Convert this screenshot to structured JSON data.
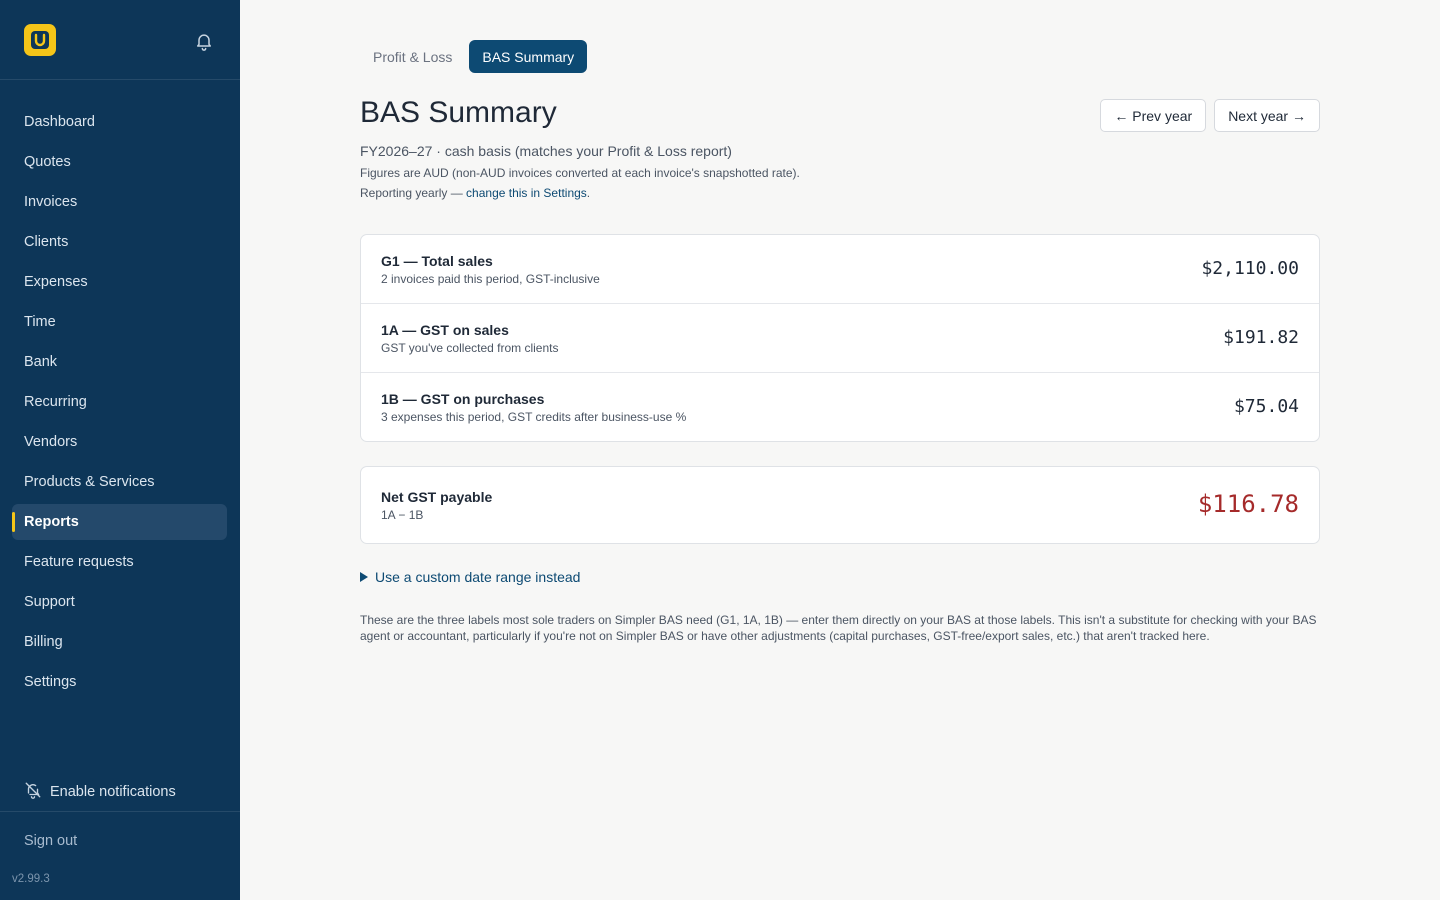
{
  "sidebar": {
    "nav": [
      {
        "label": "Dashboard",
        "active": false
      },
      {
        "label": "Quotes",
        "active": false
      },
      {
        "label": "Invoices",
        "active": false
      },
      {
        "label": "Clients",
        "active": false
      },
      {
        "label": "Expenses",
        "active": false
      },
      {
        "label": "Time",
        "active": false
      },
      {
        "label": "Bank",
        "active": false
      },
      {
        "label": "Recurring",
        "active": false
      },
      {
        "label": "Vendors",
        "active": false
      },
      {
        "label": "Products & Services",
        "active": false
      },
      {
        "label": "Reports",
        "active": true
      },
      {
        "label": "Feature requests",
        "active": false
      },
      {
        "label": "Support",
        "active": false
      },
      {
        "label": "Billing",
        "active": false
      },
      {
        "label": "Settings",
        "active": false
      }
    ],
    "enable_notifications": "Enable notifications",
    "sign_out": "Sign out",
    "version": "v2.99.3"
  },
  "tabs": [
    {
      "label": "Profit & Loss",
      "active": false
    },
    {
      "label": "BAS Summary",
      "active": true
    }
  ],
  "page": {
    "title": "BAS Summary",
    "prev_year": "← Prev year",
    "next_year": "Next year →",
    "subtitle": "FY2026–27 · cash basis (matches your Profit & Loss report)",
    "currency_note": "Figures are AUD (non-AUD invoices converted at each invoice's snapshotted rate).",
    "reporting_prefix": "Reporting yearly — ",
    "reporting_link": "change this in Settings",
    "reporting_suffix": "."
  },
  "bas_lines": [
    {
      "label": "G1 — Total sales",
      "desc": "2 invoices paid this period, GST-inclusive",
      "amount": "$2,110.00"
    },
    {
      "label": "1A — GST on sales",
      "desc": "GST you've collected from clients",
      "amount": "$191.82"
    },
    {
      "label": "1B — GST on purchases",
      "desc": "3 expenses this period, GST credits after business-use %",
      "amount": "$75.04"
    }
  ],
  "net": {
    "label": "Net GST payable",
    "desc": "1A − 1B",
    "amount": "$116.78"
  },
  "custom_range": "Use a custom date range instead",
  "disclaimer": "These are the three labels most sole traders on Simpler BAS need (G1, 1A, 1B) — enter them directly on your BAS at those labels. This isn't a substitute for checking with your BAS agent or accountant, particularly if you're not on Simpler BAS or have other adjustments (capital purchases, GST-free/export sales, etc.) that aren't tracked here.",
  "colors": {
    "sidebar_bg": "#0d3658",
    "accent_yellow": "#f5c518",
    "primary": "#0d4a73",
    "net_amount": "#a52a2a"
  }
}
